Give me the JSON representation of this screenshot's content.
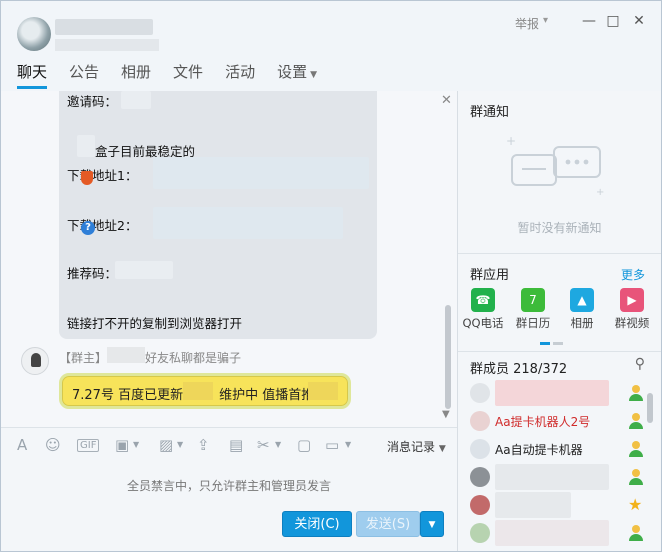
{
  "window": {
    "report_label": "举报",
    "controls": {
      "minimize": "—",
      "maximize": "□",
      "close": "✕"
    }
  },
  "tabs": [
    {
      "label": "聊天",
      "active": true
    },
    {
      "label": "公告"
    },
    {
      "label": "相册"
    },
    {
      "label": "文件"
    },
    {
      "label": "活动"
    },
    {
      "label": "设置",
      "has_dropdown": true
    }
  ],
  "chat": {
    "bubble_lines": {
      "invite": "邀请码：",
      "box_tail": "盒子目前最稳定的",
      "dl1": "下载地址1：",
      "dl2": "下载地址2：",
      "recommend": "推荐码：",
      "tip": "链接打不开的复制到浏览器打开"
    },
    "sender_tag": "【群主】",
    "sender_tail": "好友私聊都是骗子",
    "gold_message": {
      "part1": "7.27号 百度已更新",
      "part2": "维护中 值播首推"
    },
    "close_symbol": "✕"
  },
  "toolbar": {
    "icons": [
      "font-icon",
      "emoji-icon",
      "gif-icon",
      "gift-icon",
      "image-icon",
      "upload-icon",
      "red-packet-icon",
      "scissors-icon",
      "chat-bubble-icon"
    ],
    "history_label": "消息记录"
  },
  "input": {
    "muted_notice": "全员禁言中，只允许群主和管理员发言",
    "close_button": "关闭(C)",
    "send_button": "发送(S)"
  },
  "notice_panel": {
    "title": "群通知",
    "empty_text": "暂时没有新通知"
  },
  "apps_panel": {
    "title": "群应用",
    "more_label": "更多",
    "apps": [
      {
        "label": "QQ电话",
        "color": "#22b14c",
        "icon": "phone-icon"
      },
      {
        "label": "群日历",
        "color": "#3dbb3a",
        "icon": "calendar-icon",
        "icon_text": "7"
      },
      {
        "label": "相册",
        "color": "#1ea8e0",
        "icon": "photo-icon"
      },
      {
        "label": "群视频",
        "color": "#e8547a",
        "icon": "video-icon"
      }
    ]
  },
  "members_panel": {
    "title": "群成员 218/372",
    "members": [
      {
        "name": "",
        "role": "user"
      },
      {
        "name": "Aa提卡机器人2号",
        "role": "user",
        "name_color": "#d02b2b"
      },
      {
        "name": "Aa自动提卡机器",
        "role": "user",
        "name_color": "#222222"
      },
      {
        "name": "",
        "role": "user"
      },
      {
        "name": "",
        "role": "owner"
      },
      {
        "name": "",
        "role": "user"
      }
    ]
  }
}
